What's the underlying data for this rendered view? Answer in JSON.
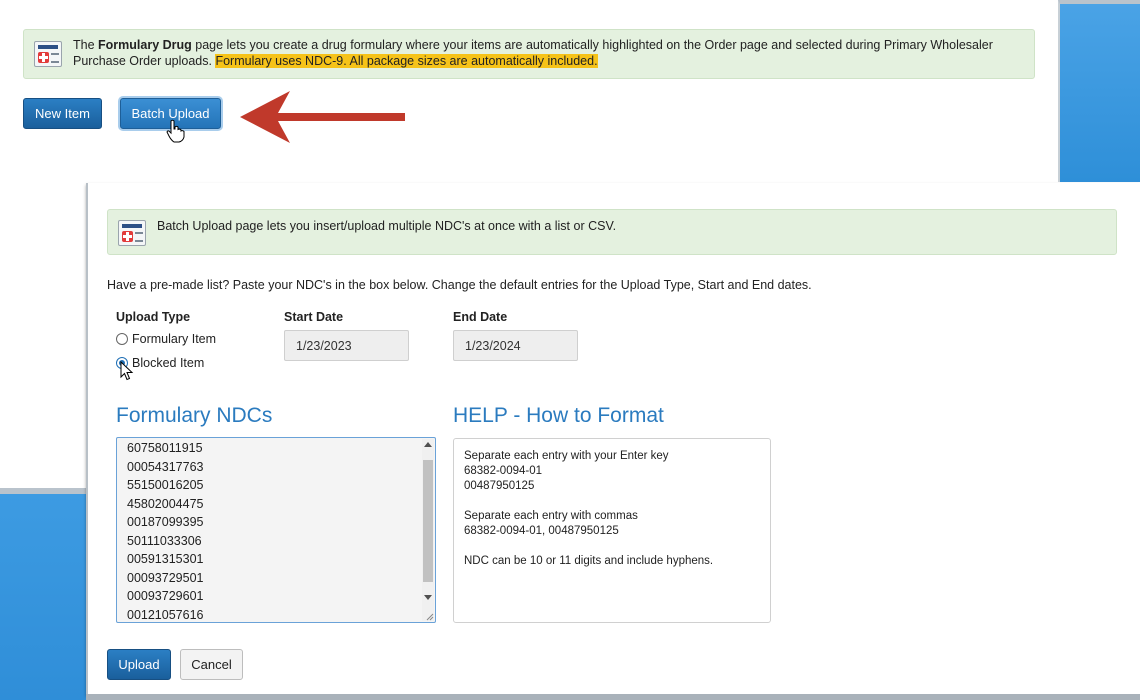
{
  "top": {
    "banner": {
      "prefix": "The ",
      "bold": "Formulary Drug",
      "text": " page lets you create a drug formulary where your items are automatically highlighted on the Order page and selected during Primary Wholesaler Purchase Order uploads. ",
      "highlight": "Formulary uses NDC-9. All package sizes are automatically included."
    },
    "new_item_label": "New Item",
    "batch_upload_label": "Batch Upload"
  },
  "batch": {
    "banner_text": "Batch Upload page lets you insert/upload multiple NDC's at once with a list or CSV.",
    "description": "Have a pre-made list? Paste your NDC's in the box below. Change the default entries for the Upload Type, Start and End dates.",
    "upload_type_label": "Upload Type",
    "options": [
      "Formulary Item",
      "Blocked Item"
    ],
    "selected_option": "Blocked Item",
    "start_date_label": "Start Date",
    "start_date": "1/23/2023",
    "end_date_label": "End Date",
    "end_date": "1/23/2024",
    "ndc_title": "Formulary NDCs",
    "ndcs": [
      "60758011915",
      "00054317763",
      "55150016205",
      "45802004475",
      "00187099395",
      "50111033306",
      "00591315301",
      "00093729501",
      "00093729601",
      "00121057616"
    ],
    "help_title": "HELP - How to Format",
    "help": {
      "line1": "Separate each entry with your Enter key",
      "line2": "68382-0094-01",
      "line3": "00487950125",
      "line4": "Separate each entry with commas",
      "line5": "68382-0094-01, 00487950125",
      "line6": "NDC can be 10 or 11 digits and include hyphens."
    },
    "upload_label": "Upload",
    "cancel_label": "Cancel"
  },
  "colors": {
    "accent": "#2b7bbf",
    "banner_bg": "#e4f1df",
    "highlight": "#f6c319",
    "arrow": "#c0392b",
    "side_panel": "#2f8ed8"
  }
}
